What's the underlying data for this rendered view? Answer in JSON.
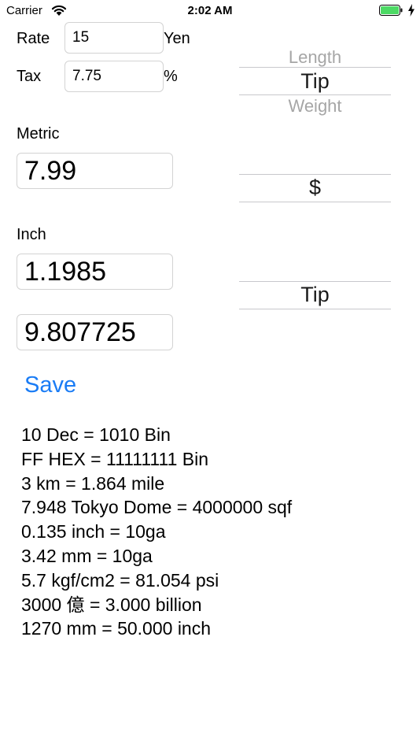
{
  "status_bar": {
    "carrier": "Carrier",
    "time": "2:02 AM",
    "wifi_icon": "wifi-icon",
    "battery_icon": "battery-icon",
    "charging_icon": "charging-bolt-icon"
  },
  "rate": {
    "label": "Rate",
    "value": "15",
    "unit": "Yen"
  },
  "tax": {
    "label": "Tax",
    "value": "7.75",
    "unit": "%"
  },
  "metric": {
    "label": "Metric",
    "value": "7.99"
  },
  "inch": {
    "label": "Inch",
    "value": "1.1985"
  },
  "result": {
    "value": "9.807725"
  },
  "category_picker": {
    "above": "Length",
    "selected": "Tip",
    "below": "Weight"
  },
  "metric_unit_picker": {
    "selected": "$"
  },
  "inch_unit_picker": {
    "selected": "Tip"
  },
  "save_label": "Save",
  "history": [
    "10 Dec = 1010 Bin",
    "FF HEX = 11111111 Bin",
    "3 km = 1.864 mile",
    "7.948 Tokyo Dome = 4000000 sqf",
    "0.135 inch =  10ga",
    "3.42 mm =  10ga",
    "5.7 kgf/cm2 = 81.054 psi",
    "3000 億 = 3.000 billion",
    "1270 mm = 50.000 inch"
  ],
  "colors": {
    "accent": "#1a7cf5",
    "battery": "#4cd964",
    "field_border": "#d3d3d3"
  }
}
